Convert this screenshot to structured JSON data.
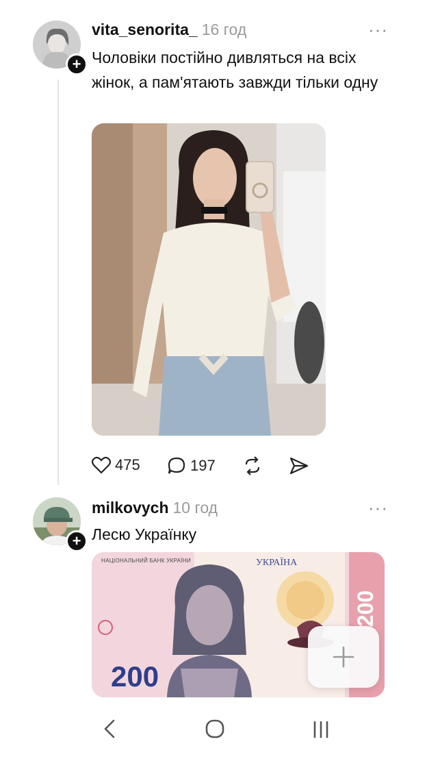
{
  "post1": {
    "username": "vita_senorita_",
    "time": "16 год",
    "text": "Чоловіки постійно дивляться на всіх жінок, а пам'ятають завжди тільки одну",
    "likes": "475",
    "comments": "197"
  },
  "post2": {
    "username": "milkovych",
    "time": "10 год",
    "text": "Лесю Українку",
    "banknote": {
      "bank_label": "НАЦІОНАЛЬНИЙ БАНК УКРАЇНИ",
      "country": "УКРАЇНА",
      "denomination": "200"
    }
  },
  "fab": {
    "icon": "plus-icon"
  },
  "nav": {
    "icons": [
      "back-chevron-icon",
      "home-circle-icon",
      "recent-apps-icon"
    ]
  }
}
